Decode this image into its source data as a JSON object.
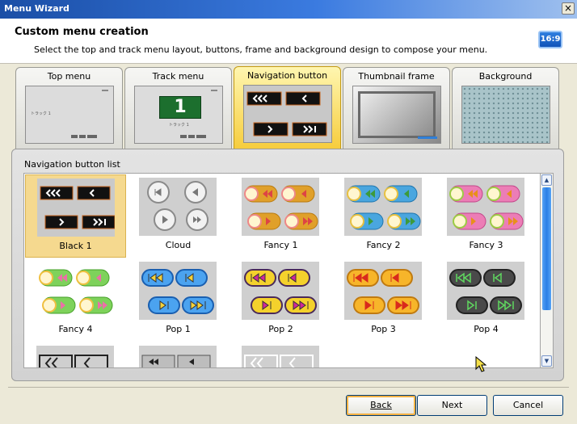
{
  "window": {
    "title": "Menu Wizard",
    "close_symbol": "×"
  },
  "header": {
    "title": "Custom menu creation",
    "description": "Select the top and track menu layout, buttons, frame and background design to compose your menu.",
    "aspect_badge": "16:9"
  },
  "tabs": [
    {
      "label": "Top menu",
      "selected": false
    },
    {
      "label": "Track menu",
      "selected": false
    },
    {
      "label": "Navigation button",
      "selected": true
    },
    {
      "label": "Thumbnail frame",
      "selected": false
    },
    {
      "label": "Background",
      "selected": false
    }
  ],
  "tab_previews": {
    "top_menu_track_text": "トラック 1",
    "track_menu_number": "1",
    "track_menu_track_text": "トラック 1"
  },
  "nav_list": {
    "title": "Navigation button list",
    "items": [
      {
        "label": "Black 1",
        "selected": true
      },
      {
        "label": "Cloud",
        "selected": false
      },
      {
        "label": "Fancy 1",
        "selected": false
      },
      {
        "label": "Fancy 2",
        "selected": false
      },
      {
        "label": "Fancy 3",
        "selected": false
      },
      {
        "label": "Fancy 4",
        "selected": false
      },
      {
        "label": "Pop 1",
        "selected": false
      },
      {
        "label": "Pop 2",
        "selected": false
      },
      {
        "label": "Pop 3",
        "selected": false
      },
      {
        "label": "Pop 4",
        "selected": false
      }
    ]
  },
  "scrollbar": {
    "up": "▲",
    "down": "▼"
  },
  "footer": {
    "back_label": "Back",
    "next_label": "Next",
    "cancel_label": "Cancel"
  },
  "colors": {
    "title_bar": "#1a4ea6",
    "selected_tab": "#f6cc3b",
    "selected_item": "#f5d98f",
    "scroll_thumb": "#2a7fe6"
  }
}
